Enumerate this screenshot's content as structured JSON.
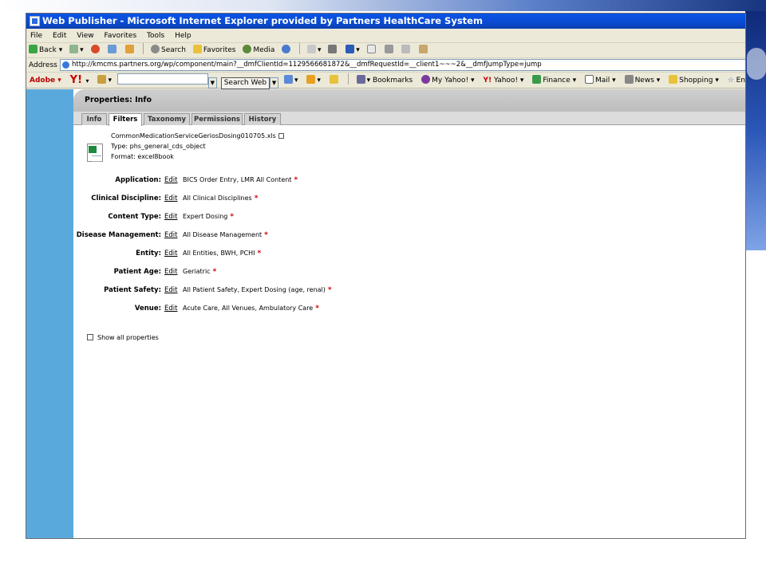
{
  "window": {
    "title": "Web Publisher - Microsoft Internet Explorer provided by Partners HealthCare System"
  },
  "menu": [
    "File",
    "Edit",
    "View",
    "Favorites",
    "Tools",
    "Help"
  ],
  "toolbar": {
    "back": "Back",
    "search": "Search",
    "favorites": "Favorites",
    "media": "Media"
  },
  "address": {
    "label": "Address",
    "url": "http://kmcms.partners.org/wp/component/main?__dmfClientId=1129566681872&__dmfRequestId=__client1~~~2&__dmfJumpType=jump"
  },
  "yahoo_toolbar": {
    "adobe": "Adobe",
    "search_button": "Search Web",
    "bookmarks": "Bookmarks",
    "my_yahoo": "My Yahoo!",
    "yahoo": "Yahoo!",
    "finance": "Finance",
    "mail": "Mail",
    "news": "News",
    "shopping": "Shopping",
    "entertainment": "Entertainment"
  },
  "panel": {
    "title": "Properties: Info",
    "tabs": [
      {
        "label": "Info",
        "active": false
      },
      {
        "label": "Filters",
        "active": true
      },
      {
        "label": "Taxonomy",
        "active": false
      },
      {
        "label": "Permissions",
        "active": false
      },
      {
        "label": "History",
        "active": false
      }
    ]
  },
  "file": {
    "name": "CommonMedicationServiceGeriosDosing010705.xls",
    "type": "Type: phs_general_cds_object",
    "format": "Format: excel8book"
  },
  "properties": [
    {
      "label": "Application:",
      "edit": "Edit",
      "value": "BICS Order Entry, LMR All Content"
    },
    {
      "label": "Clinical Discipline:",
      "edit": "Edit",
      "value": "All Clinical Disciplines"
    },
    {
      "label": "Content Type:",
      "edit": "Edit",
      "value": "Expert Dosing"
    },
    {
      "label": "Disease Management:",
      "edit": "Edit",
      "value": "All Disease Management"
    },
    {
      "label": "Entity:",
      "edit": "Edit",
      "value": "All Entities, BWH, PCHI"
    },
    {
      "label": "Patient Age:",
      "edit": "Edit",
      "value": "Geriatric"
    },
    {
      "label": "Patient Safety:",
      "edit": "Edit",
      "value": "All Patient Safety, Expert Dosing (age, renal)"
    },
    {
      "label": "Venue:",
      "edit": "Edit",
      "value": "Acute Care, All Venues, Ambulatory Care"
    }
  ],
  "required_mark": "*",
  "show_all": {
    "label": "Show all properties",
    "checked": false
  },
  "colors": {
    "titlebar": "#0a54e6",
    "leftnav": "#5aa9dd",
    "required": "#d00000"
  }
}
